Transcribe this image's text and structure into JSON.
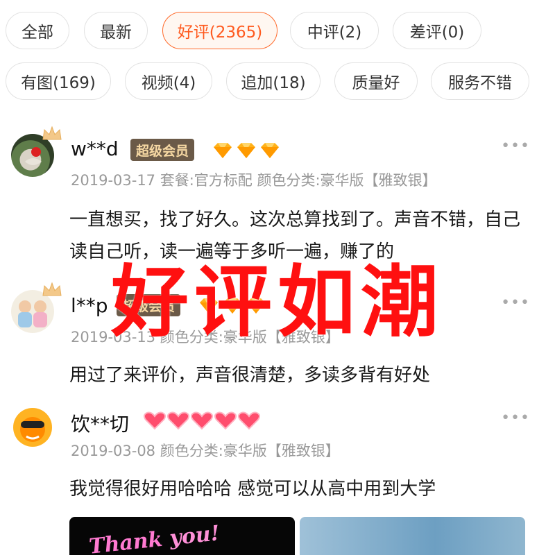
{
  "filters": {
    "row1": [
      {
        "label": "全部",
        "active": false
      },
      {
        "label": "最新",
        "active": false
      },
      {
        "label": "好评(2365)",
        "active": true
      },
      {
        "label": "中评(2)",
        "active": false
      },
      {
        "label": "差评(0)",
        "active": false
      }
    ],
    "row2": [
      {
        "label": "有图(169)",
        "active": false
      },
      {
        "label": "视频(4)",
        "active": false
      },
      {
        "label": "追加(18)",
        "active": false
      },
      {
        "label": "质量好",
        "active": false
      },
      {
        "label": "服务不错",
        "active": false
      }
    ]
  },
  "reviews": [
    {
      "user": "w**d",
      "badge": "超级会员",
      "level_icon": "diamond-icon",
      "level_count": 3,
      "more": "•••",
      "meta": "2019-03-17 套餐:官方标配 颜色分类:豪华版【雅致银】",
      "text": "一直想买，找了好久。这次总算找到了。声音不错，自己读自己听，读一遍等于多听一遍，赚了的"
    },
    {
      "user": "l**p",
      "badge": "超级会员",
      "level_icon": "diamond-icon",
      "level_count": 3,
      "more": "•••",
      "meta": "2019-03-13 颜色分类:豪华版【雅致银】",
      "text": "用过了来评价，声音很清楚，多读多背有好处"
    },
    {
      "user": "饮**切",
      "badge": "",
      "level_icon": "heart-icon",
      "level_count": 5,
      "more": "•••",
      "meta": "2019-03-08 颜色分类:豪华版【雅致银】",
      "text": "我觉得很好用哈哈哈 感觉可以从高中用到大学"
    }
  ],
  "overlay_text": "好评如潮",
  "photo_text": {
    "word1": "Thank",
    "word2": "you!"
  },
  "colors": {
    "accent": "#ff5a1f",
    "overlay": "#ff1010",
    "badge_bg": "#6b5a48",
    "badge_text": "#f6d8a3",
    "meta": "#999999"
  }
}
